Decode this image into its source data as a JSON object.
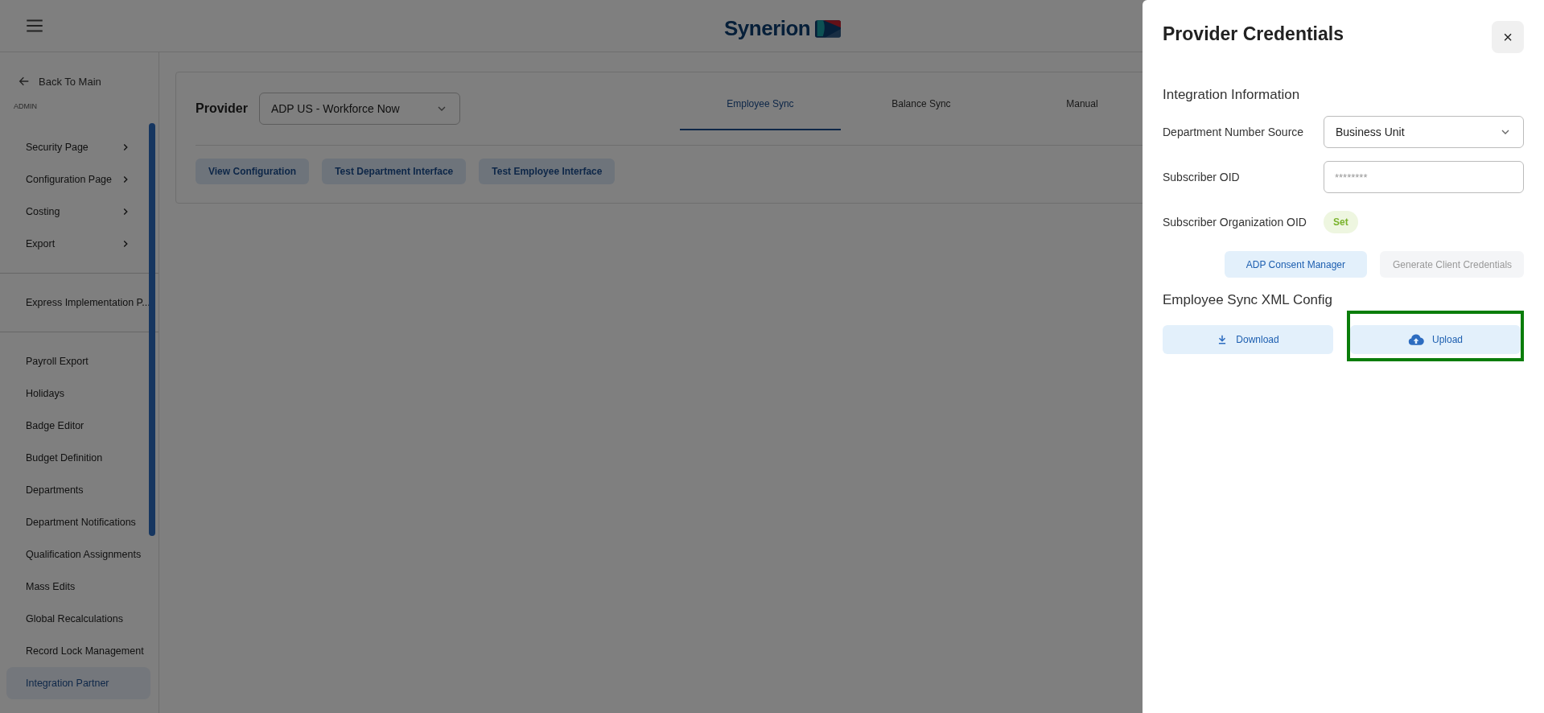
{
  "header": {
    "logo": "Synerion"
  },
  "sidebar": {
    "back": "Back To Main",
    "section": "ADMIN",
    "groups": [
      [
        {
          "label": "Security Page",
          "expandable": true,
          "selected": false
        },
        {
          "label": "Configuration Page",
          "expandable": true,
          "selected": false
        },
        {
          "label": "Costing",
          "expandable": true,
          "selected": false
        },
        {
          "label": "Export",
          "expandable": true,
          "selected": false
        }
      ],
      [
        {
          "label": "Express Implementation P...",
          "expandable": false,
          "selected": false
        }
      ],
      [
        {
          "label": "Payroll Export",
          "expandable": false,
          "selected": false
        },
        {
          "label": "Holidays",
          "expandable": false,
          "selected": false
        },
        {
          "label": "Badge Editor",
          "expandable": false,
          "selected": false
        },
        {
          "label": "Budget Definition",
          "expandable": false,
          "selected": false
        },
        {
          "label": "Departments",
          "expandable": false,
          "selected": false
        },
        {
          "label": "Department Notifications",
          "expandable": false,
          "selected": false
        },
        {
          "label": "Qualification Assignments",
          "expandable": false,
          "selected": false
        },
        {
          "label": "Mass Edits",
          "expandable": false,
          "selected": false
        },
        {
          "label": "Global Recalculations",
          "expandable": false,
          "selected": false
        },
        {
          "label": "Record Lock Management",
          "expandable": false,
          "selected": false
        },
        {
          "label": "Integration Partner",
          "expandable": false,
          "selected": true
        }
      ]
    ]
  },
  "main": {
    "provider_label": "Provider",
    "provider_value": "ADP US - Workforce Now",
    "tabs": [
      {
        "label": "Employee Sync",
        "selected": true
      },
      {
        "label": "Balance Sync",
        "selected": false
      },
      {
        "label": "Manual",
        "selected": false
      }
    ],
    "buttons": [
      "View Configuration",
      "Test Department Interface",
      "Test Employee Interface"
    ]
  },
  "panel": {
    "title": "Provider Credentials",
    "close": "×",
    "section": "Integration Information",
    "fields": [
      {
        "kind": "select",
        "label": "Department Number Source",
        "value": "Business Unit"
      },
      {
        "kind": "input",
        "label": "Subscriber OID",
        "placeholder": "********"
      },
      {
        "kind": "badge",
        "label": "Subscriber Organization OID",
        "value": "Set"
      }
    ],
    "actions": [
      {
        "label": "ADP Consent Manager",
        "disabled": false
      },
      {
        "label": "Generate Client Credentials",
        "disabled": true
      }
    ],
    "xml_section": "Employee Sync XML Config",
    "xml_buttons": [
      {
        "kind": "download",
        "label": "Download",
        "highlighted": false
      },
      {
        "kind": "upload",
        "label": "Upload",
        "highlighted": true
      }
    ]
  }
}
